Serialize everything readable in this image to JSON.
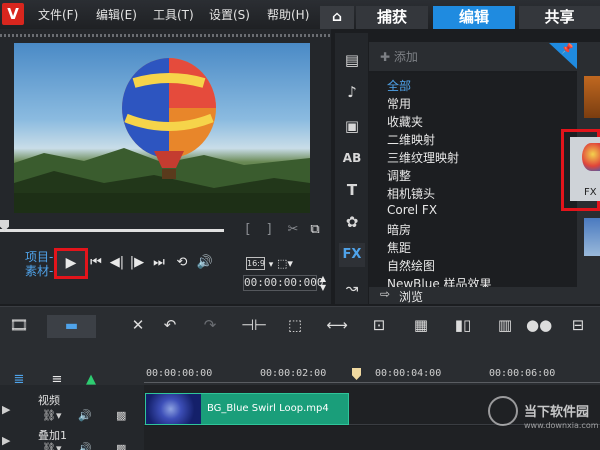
{
  "app": {
    "logo_letter": "V"
  },
  "menu": [
    "文件(F)",
    "编辑(E)",
    "工具(T)",
    "设置(S)",
    "帮助(H)"
  ],
  "workspace_tabs": {
    "home_icon": "home-icon",
    "capture": "捕获",
    "edit": "编辑",
    "share": "共享",
    "active": "编辑"
  },
  "player": {
    "source_labels": {
      "project": "项目-",
      "clip": "素材-"
    },
    "timecode": "00:00:00:000",
    "aspect": "16:9",
    "scrub_position": 0.0
  },
  "library": {
    "add_label": "添加",
    "categories": [
      "全部",
      "常用",
      "收藏夹",
      "二维映射",
      "三维纹理映射",
      "调整",
      "相机镜头",
      "Corel FX",
      "暗房",
      "焦距",
      "自然绘图",
      "NewBlue 样品效果"
    ],
    "selected_category": "全部",
    "browse_label": "浏览",
    "side_icons": [
      "media-icon",
      "audio-icon",
      "instant-project-icon",
      "transition-icon",
      "title-icon",
      "graphic-icon",
      "fx-icon",
      "path-icon"
    ],
    "fx_label": "FX",
    "thumb_fx_label": "FX"
  },
  "timeline": {
    "ruler": [
      "00:00:00:00",
      "00:00:02:00",
      "00:00:04:00",
      "00:00:06:00"
    ],
    "tracks": [
      {
        "name": "视频"
      },
      {
        "name": "叠加1"
      }
    ],
    "clip": {
      "name": "BG_Blue Swirl Loop.mp4"
    }
  },
  "watermark": {
    "text": "当下软件园",
    "url": "www.downxia.com"
  },
  "colors": {
    "accent": "#1f8be0",
    "highlight": "#e3141b",
    "clip": "#1a9e7a"
  }
}
